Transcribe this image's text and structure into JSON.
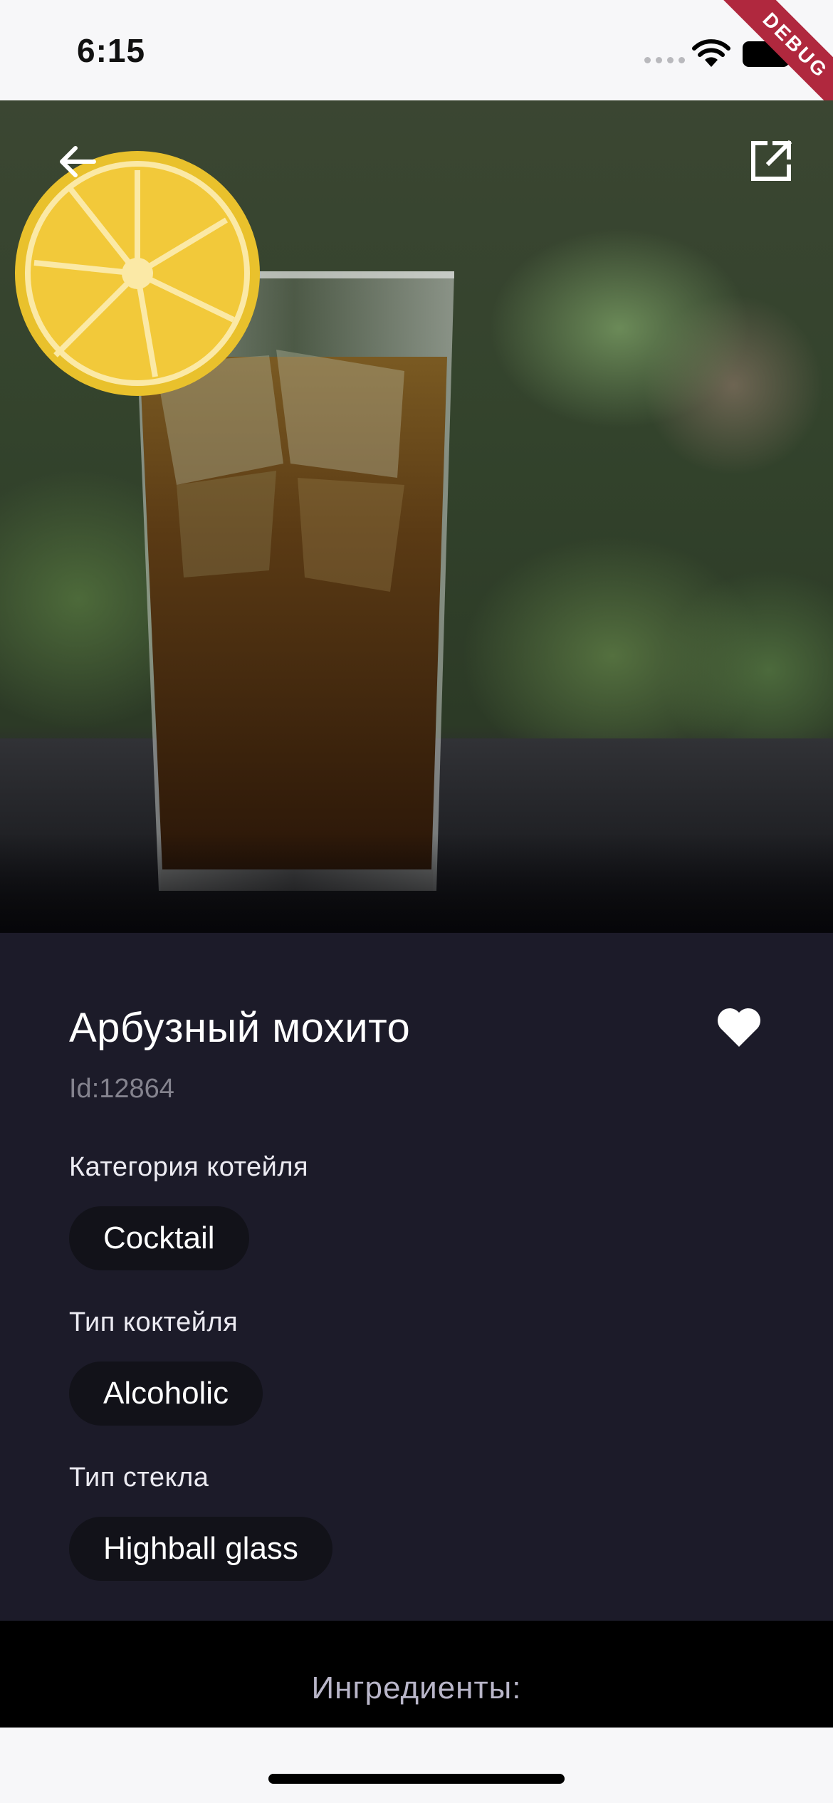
{
  "status_bar": {
    "time": "6:15",
    "debug_label": "DEBUG"
  },
  "hero": {
    "icons": [
      "back-arrow-icon",
      "open-external-icon"
    ]
  },
  "drink": {
    "name": "Арбузный мохито",
    "id_text": "Id:12864",
    "favorite": true,
    "favorite_icon": "heart-icon",
    "category_label": "Категория котейля",
    "category": "Cocktail",
    "type_label": "Тип коктейля",
    "type": "Alcoholic",
    "glass_label": "Тип стекла",
    "glass": "Highball glass"
  },
  "ingredients": {
    "title": "Ингредиенты:"
  },
  "colors": {
    "panel": "#1c1b29",
    "chip": "#121219",
    "debug": "#b0283e",
    "ingredients_title": "#b9b6c9"
  }
}
